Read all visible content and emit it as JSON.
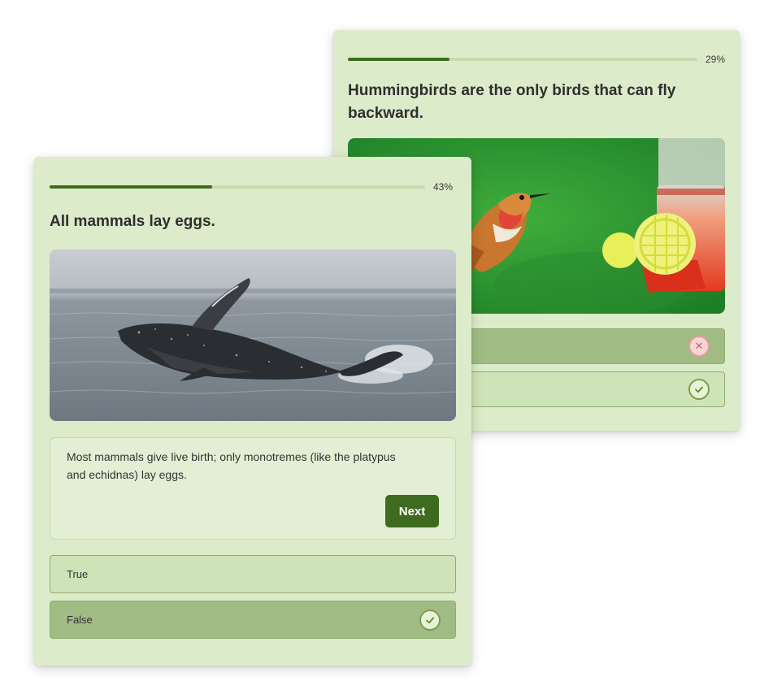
{
  "back_card": {
    "progress_label": "29%",
    "progress_fraction": 0.29,
    "question": "Hummingbirds are the only birds that can fly backward.",
    "image": "hummingbird-at-feeder",
    "options": [
      {
        "label": "",
        "state": "incorrect",
        "icon": "x-icon"
      },
      {
        "label": "",
        "state": "correct",
        "icon": "check-icon"
      }
    ]
  },
  "front_card": {
    "progress_label": "43%",
    "progress_fraction": 0.43,
    "question": "All mammals lay eggs.",
    "image": "breaching-humpback-whale",
    "feedback": "Most mammals give live birth; only monotremes (like the platypus and echidnas) lay eggs.",
    "next_label": "Next",
    "options": [
      {
        "label": "True",
        "state": "default"
      },
      {
        "label": "False",
        "state": "selected-correct",
        "icon": "check-icon"
      }
    ]
  },
  "colors": {
    "card_bg": "#dcebc9",
    "accent": "#3e6b1f",
    "option_bg": "#cfe3b8",
    "option_selected_bg": "#a0bb83"
  }
}
